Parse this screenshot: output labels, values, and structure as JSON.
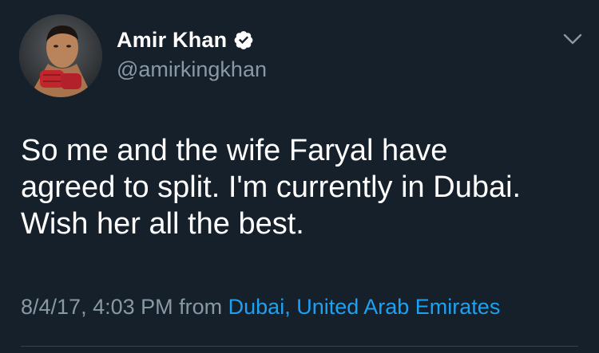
{
  "tweet": {
    "author": {
      "display_name": "Amir Khan",
      "handle": "@amirkingkhan",
      "verified": true
    },
    "text_lines": [
      "So me and the wife Faryal have",
      "agreed to split. I'm currently in Dubai.",
      "Wish her all the best."
    ],
    "timestamp": "8/4/17, 4:03 PM",
    "from_label": "from",
    "location": "Dubai, United Arab Emirates"
  },
  "icons": {
    "verified": "verified-badge-icon",
    "menu": "chevron-down-icon"
  },
  "colors": {
    "background": "#15202b",
    "primary_text": "#ffffff",
    "secondary_text": "#8899a6",
    "link": "#1da1f2"
  }
}
